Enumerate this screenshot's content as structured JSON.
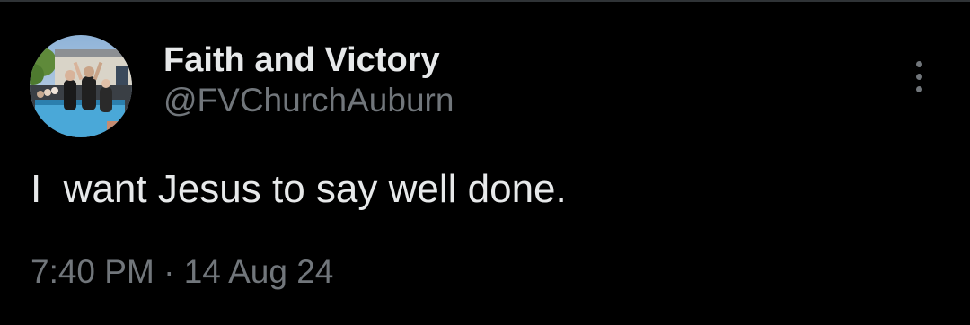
{
  "tweet": {
    "author": {
      "display_name": "Faith and Victory",
      "handle": "@FVChurchAuburn",
      "avatar_icon": "avatar-photo"
    },
    "more_icon": "more-vertical-icon",
    "text": "I  want Jesus to say well done.",
    "time": "7:40 PM",
    "separator": "·",
    "date": "14 Aug 24"
  },
  "colors": {
    "background": "#000000",
    "primary_text": "#e7e9ea",
    "secondary_text": "#71767b",
    "border": "#2f3336"
  }
}
